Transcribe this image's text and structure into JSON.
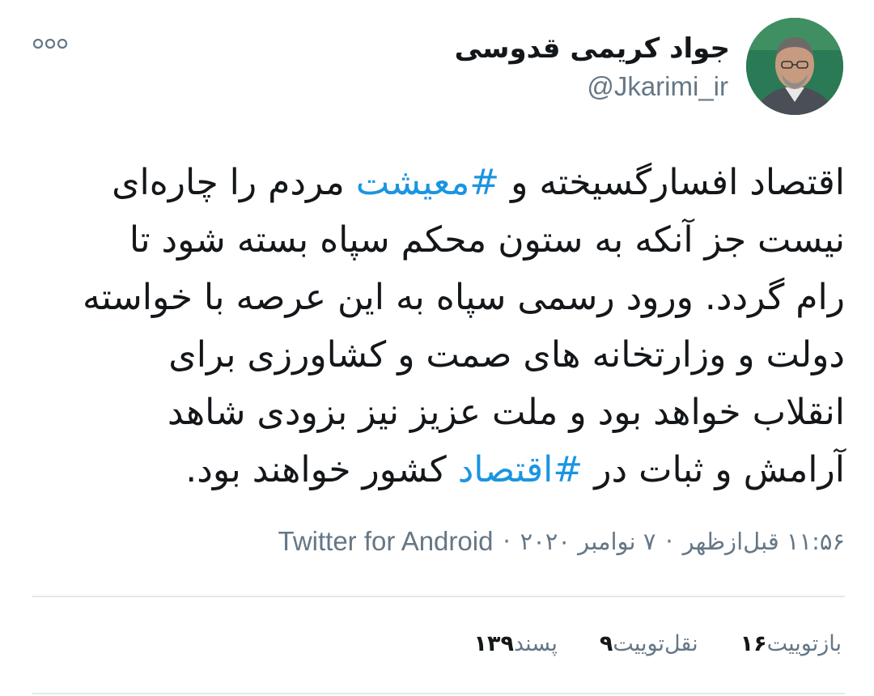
{
  "author": {
    "display_name": "جواد کریمی قدوسی",
    "handle": "@Jkarimi_ir"
  },
  "tweet": {
    "lines": [
      [
        {
          "text": "اقتصاد افسارگسیخته و ",
          "tag": false
        },
        {
          "text": "#معیشت",
          "tag": true
        },
        {
          "text": " مردم را چاره‌ای",
          "tag": false
        }
      ],
      [
        {
          "text": "نیست جز آنکه به ستون محکم سپاه بسته شود تا",
          "tag": false
        }
      ],
      [
        {
          "text": "رام گردد. ورود رسمی سپاه به این عرصه با خواسته",
          "tag": false
        }
      ],
      [
        {
          "text": "دولت و وزارتخانه های صمت و کشاورزی برای",
          "tag": false
        }
      ],
      [
        {
          "text": "انقلاب خواهد بود و ملت عزیز نیز بزودی شاهد",
          "tag": false
        }
      ],
      [
        {
          "text": "آرامش و ثبات در ",
          "tag": false
        },
        {
          "text": "#اقتصاد",
          "tag": true
        },
        {
          "text": " کشور خواهند بود.",
          "tag": false
        }
      ]
    ]
  },
  "meta": {
    "time": "۱۱:۵۶ قبل‌ازظهر",
    "date": "۷ نوامبر ۲۰۲۰",
    "separator": "·",
    "source": "Twitter for Android"
  },
  "stats": {
    "retweets_count": "۱۶",
    "retweets_label": "بازتوییت",
    "quotes_count": "۹",
    "quotes_label": "نقل‌توییت",
    "likes_count": "۱۳۹",
    "likes_label": "پسند"
  },
  "colors": {
    "hashtag": "#1b95e0",
    "secondary_text": "#657786",
    "primary_text": "#14171a",
    "divider": "#e1e8ed"
  },
  "icons": {
    "more": "more-dots-icon",
    "avatar": "profile-photo"
  }
}
